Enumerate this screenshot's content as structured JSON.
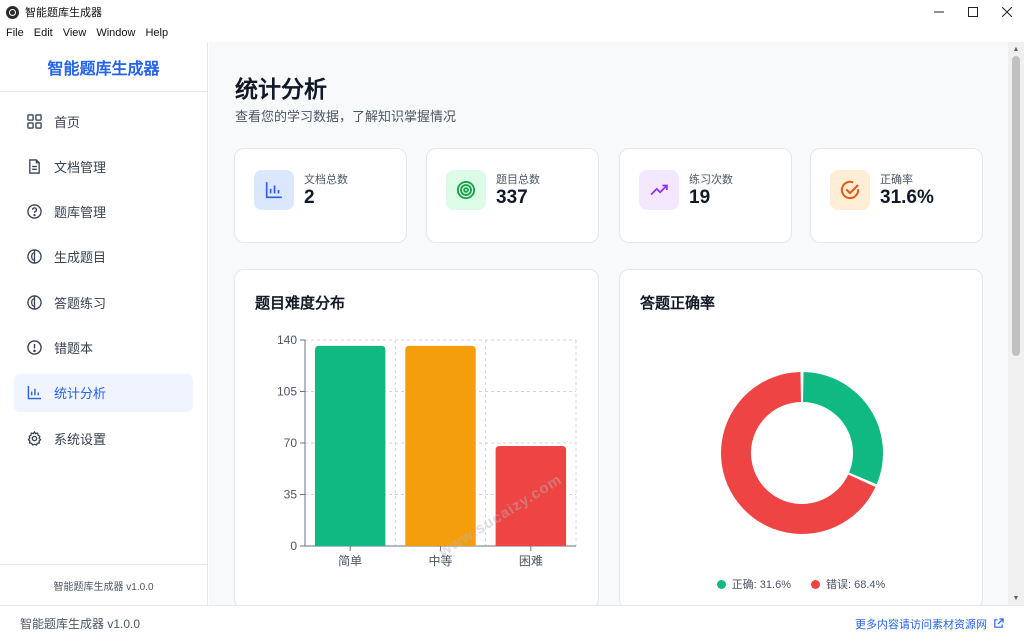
{
  "window": {
    "title": "智能题库生成器"
  },
  "menu": [
    "File",
    "Edit",
    "View",
    "Window",
    "Help"
  ],
  "sidebar": {
    "brand": "智能题库生成器",
    "items": [
      {
        "label": "首页",
        "icon": "dashboard-icon"
      },
      {
        "label": "文档管理",
        "icon": "document-icon"
      },
      {
        "label": "题库管理",
        "icon": "question-circle-icon"
      },
      {
        "label": "生成题目",
        "icon": "brain-icon"
      },
      {
        "label": "答题练习",
        "icon": "brain-icon"
      },
      {
        "label": "错题本",
        "icon": "alert-circle-icon"
      },
      {
        "label": "统计分析",
        "icon": "bar-chart-icon",
        "active": true
      },
      {
        "label": "系统设置",
        "icon": "gear-icon"
      }
    ],
    "version": "智能题库生成器 v1.0.0"
  },
  "main": {
    "title": "统计分析",
    "subtitle": "查看您的学习数据，了解知识掌握情况",
    "stats": [
      {
        "label": "文档总数",
        "value": "2",
        "icon": "bar-chart-icon",
        "color": "#2563eb",
        "bg": "#dbe7fd"
      },
      {
        "label": "题目总数",
        "value": "337",
        "icon": "target-icon",
        "color": "#16a34a",
        "bg": "#dcfce7"
      },
      {
        "label": "练习次数",
        "value": "19",
        "icon": "trending-up-icon",
        "color": "#9333ea",
        "bg": "#f3e8ff"
      },
      {
        "label": "正确率",
        "value": "31.6%",
        "icon": "check-circle-icon",
        "color": "#ea580c",
        "bg": "#ffedd5"
      }
    ],
    "difficulty_panel": {
      "title": "题目难度分布"
    },
    "accuracy_panel": {
      "title": "答题正确率"
    }
  },
  "chart_data": [
    {
      "type": "bar",
      "title": "题目难度分布",
      "categories": [
        "简单",
        "中等",
        "困难"
      ],
      "values": [
        136,
        136,
        68
      ],
      "colors": [
        "#10b981",
        "#f59e0b",
        "#ef4444"
      ],
      "yticks": [
        0,
        35,
        70,
        105,
        140
      ],
      "ylim": [
        0,
        140
      ],
      "grid": true
    },
    {
      "type": "pie",
      "title": "答题正确率",
      "donut": true,
      "labels": [
        "正确",
        "错误"
      ],
      "values": [
        31.6,
        68.4
      ],
      "legend": [
        "正确: 31.6%",
        "错误: 68.4%"
      ],
      "colors": [
        "#10b981",
        "#ef4444"
      ],
      "legend_position": "bottom"
    }
  ],
  "statusbar": {
    "left": "智能题库生成器 v1.0.0",
    "link": "更多内容请访问素材资源网"
  },
  "watermark": "www.sucaizy.com"
}
